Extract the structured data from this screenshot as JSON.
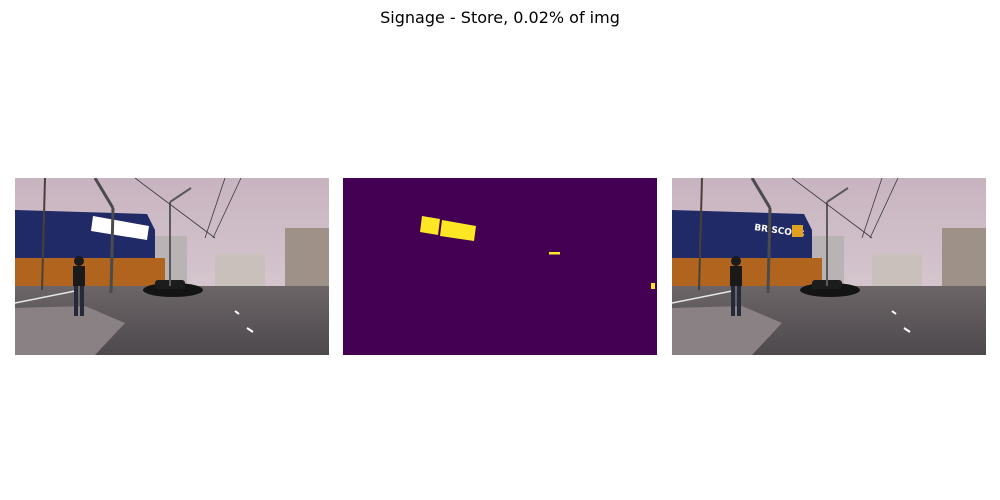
{
  "figure": {
    "title": "Signage - Store, 0.02% of img"
  },
  "panels": [
    {
      "name": "masked-image",
      "masked_region_color": "#ffffff"
    },
    {
      "name": "segmentation-mask",
      "background_color": "#440154",
      "mask_color": "#fde725"
    },
    {
      "name": "original-image",
      "sign_text": "BRISCOES",
      "sign_color": "#1f2e7a"
    }
  ]
}
